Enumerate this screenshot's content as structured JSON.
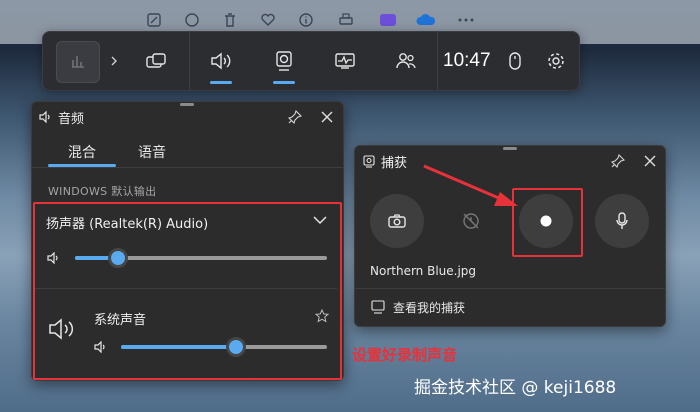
{
  "gamebar": {
    "time": "10:47",
    "buttons": [
      "widget-menu-icon",
      "audio-icon",
      "capture-icon",
      "performance-icon",
      "xbox-social-icon"
    ]
  },
  "audio_panel": {
    "title": "音频",
    "tabs": [
      {
        "label": "混合",
        "active": true
      },
      {
        "label": "语音",
        "active": false
      }
    ],
    "output_label": "WINDOWS 默认输出",
    "device": "扬声器 (Realtek(R) Audio)",
    "device_volume": 0.17,
    "app_name": "系统声音",
    "app_volume": 0.56
  },
  "capture_panel": {
    "title": "捕获",
    "filename": "Northern Blue.jpg",
    "link": "查看我的捕获"
  },
  "annotation": "设置好录制声音",
  "watermark": "掘金技术社区 @ keji1688",
  "colors": {
    "accent": "#5aaaf0",
    "annotation": "#e8323a",
    "panel": "#2c2c2c"
  }
}
